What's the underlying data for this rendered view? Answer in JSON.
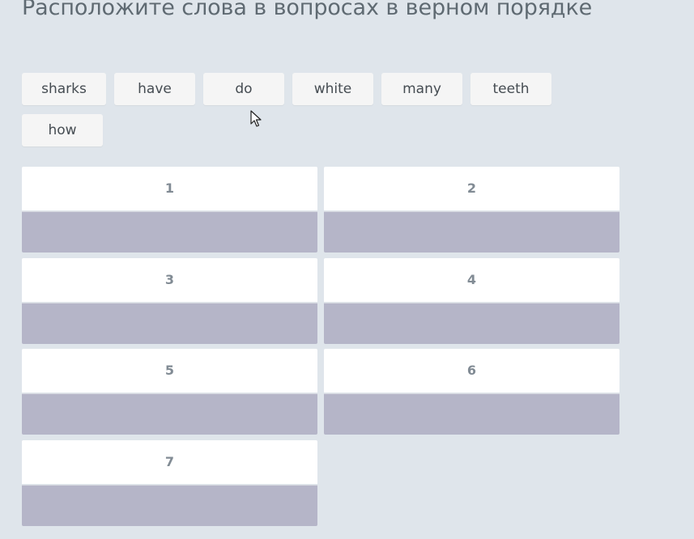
{
  "task": {
    "title": "Расположите слова в вопросах в верном порядке"
  },
  "words": [
    "sharks",
    "have",
    "do",
    "white",
    "many",
    "teeth",
    "how"
  ],
  "slots": [
    "1",
    "2",
    "3",
    "4",
    "5",
    "6",
    "7"
  ],
  "colors": {
    "background": "#dfe5eb",
    "chip": "#f5f5f5",
    "slot_header": "#ffffff",
    "drop_zone": "#b5b5c8",
    "slot_number": "#818b94"
  }
}
